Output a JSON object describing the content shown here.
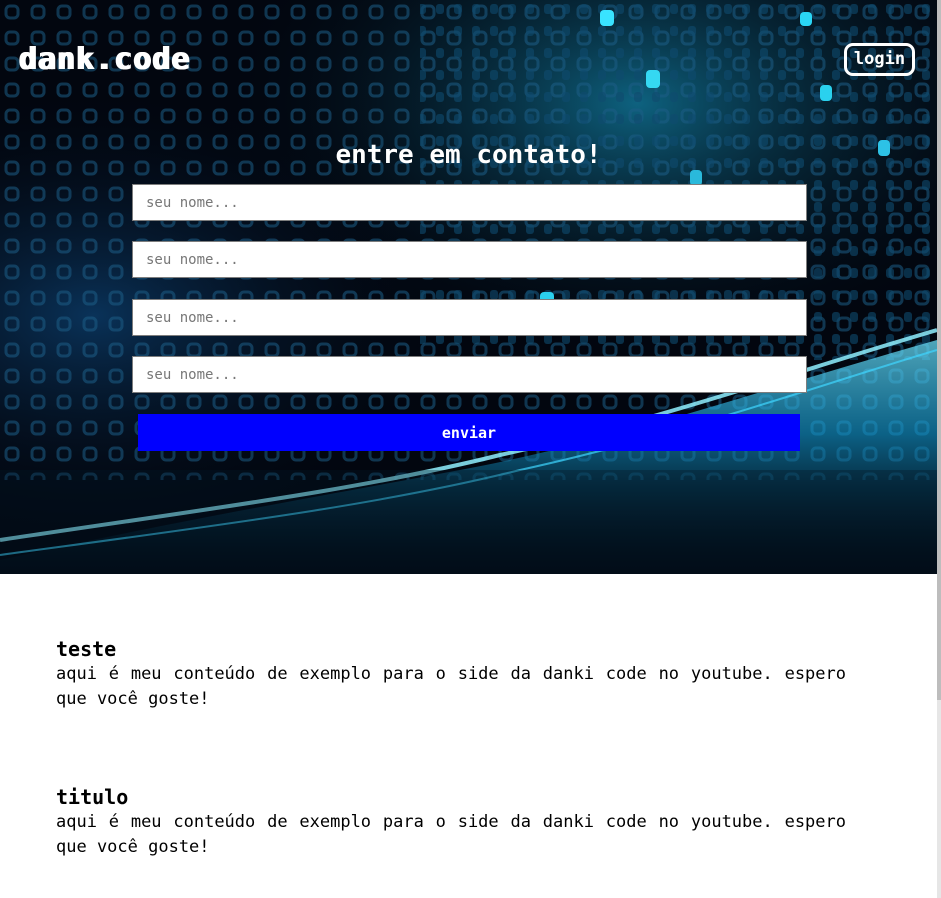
{
  "header": {
    "logo": "dank.code",
    "login_label": "login"
  },
  "contact_form": {
    "title": "entre em contato!",
    "fields": [
      {
        "placeholder": "seu nome..."
      },
      {
        "placeholder": "seu nome..."
      },
      {
        "placeholder": "seu nome..."
      },
      {
        "placeholder": "seu nome..."
      }
    ],
    "submit_label": "enviar"
  },
  "articles": [
    {
      "title": "teste",
      "body": "aqui é meu conteúdo de exemplo para o side da danki code no youtube. espero que você goste!"
    },
    {
      "title": "titulo",
      "body": "aqui é meu conteúdo de exemplo para o side da danki code no youtube. espero que você goste!"
    }
  ],
  "colors": {
    "accent_button": "#0000ff",
    "hero_background": "#02060f",
    "hero_glow": "#1fc8ff"
  }
}
